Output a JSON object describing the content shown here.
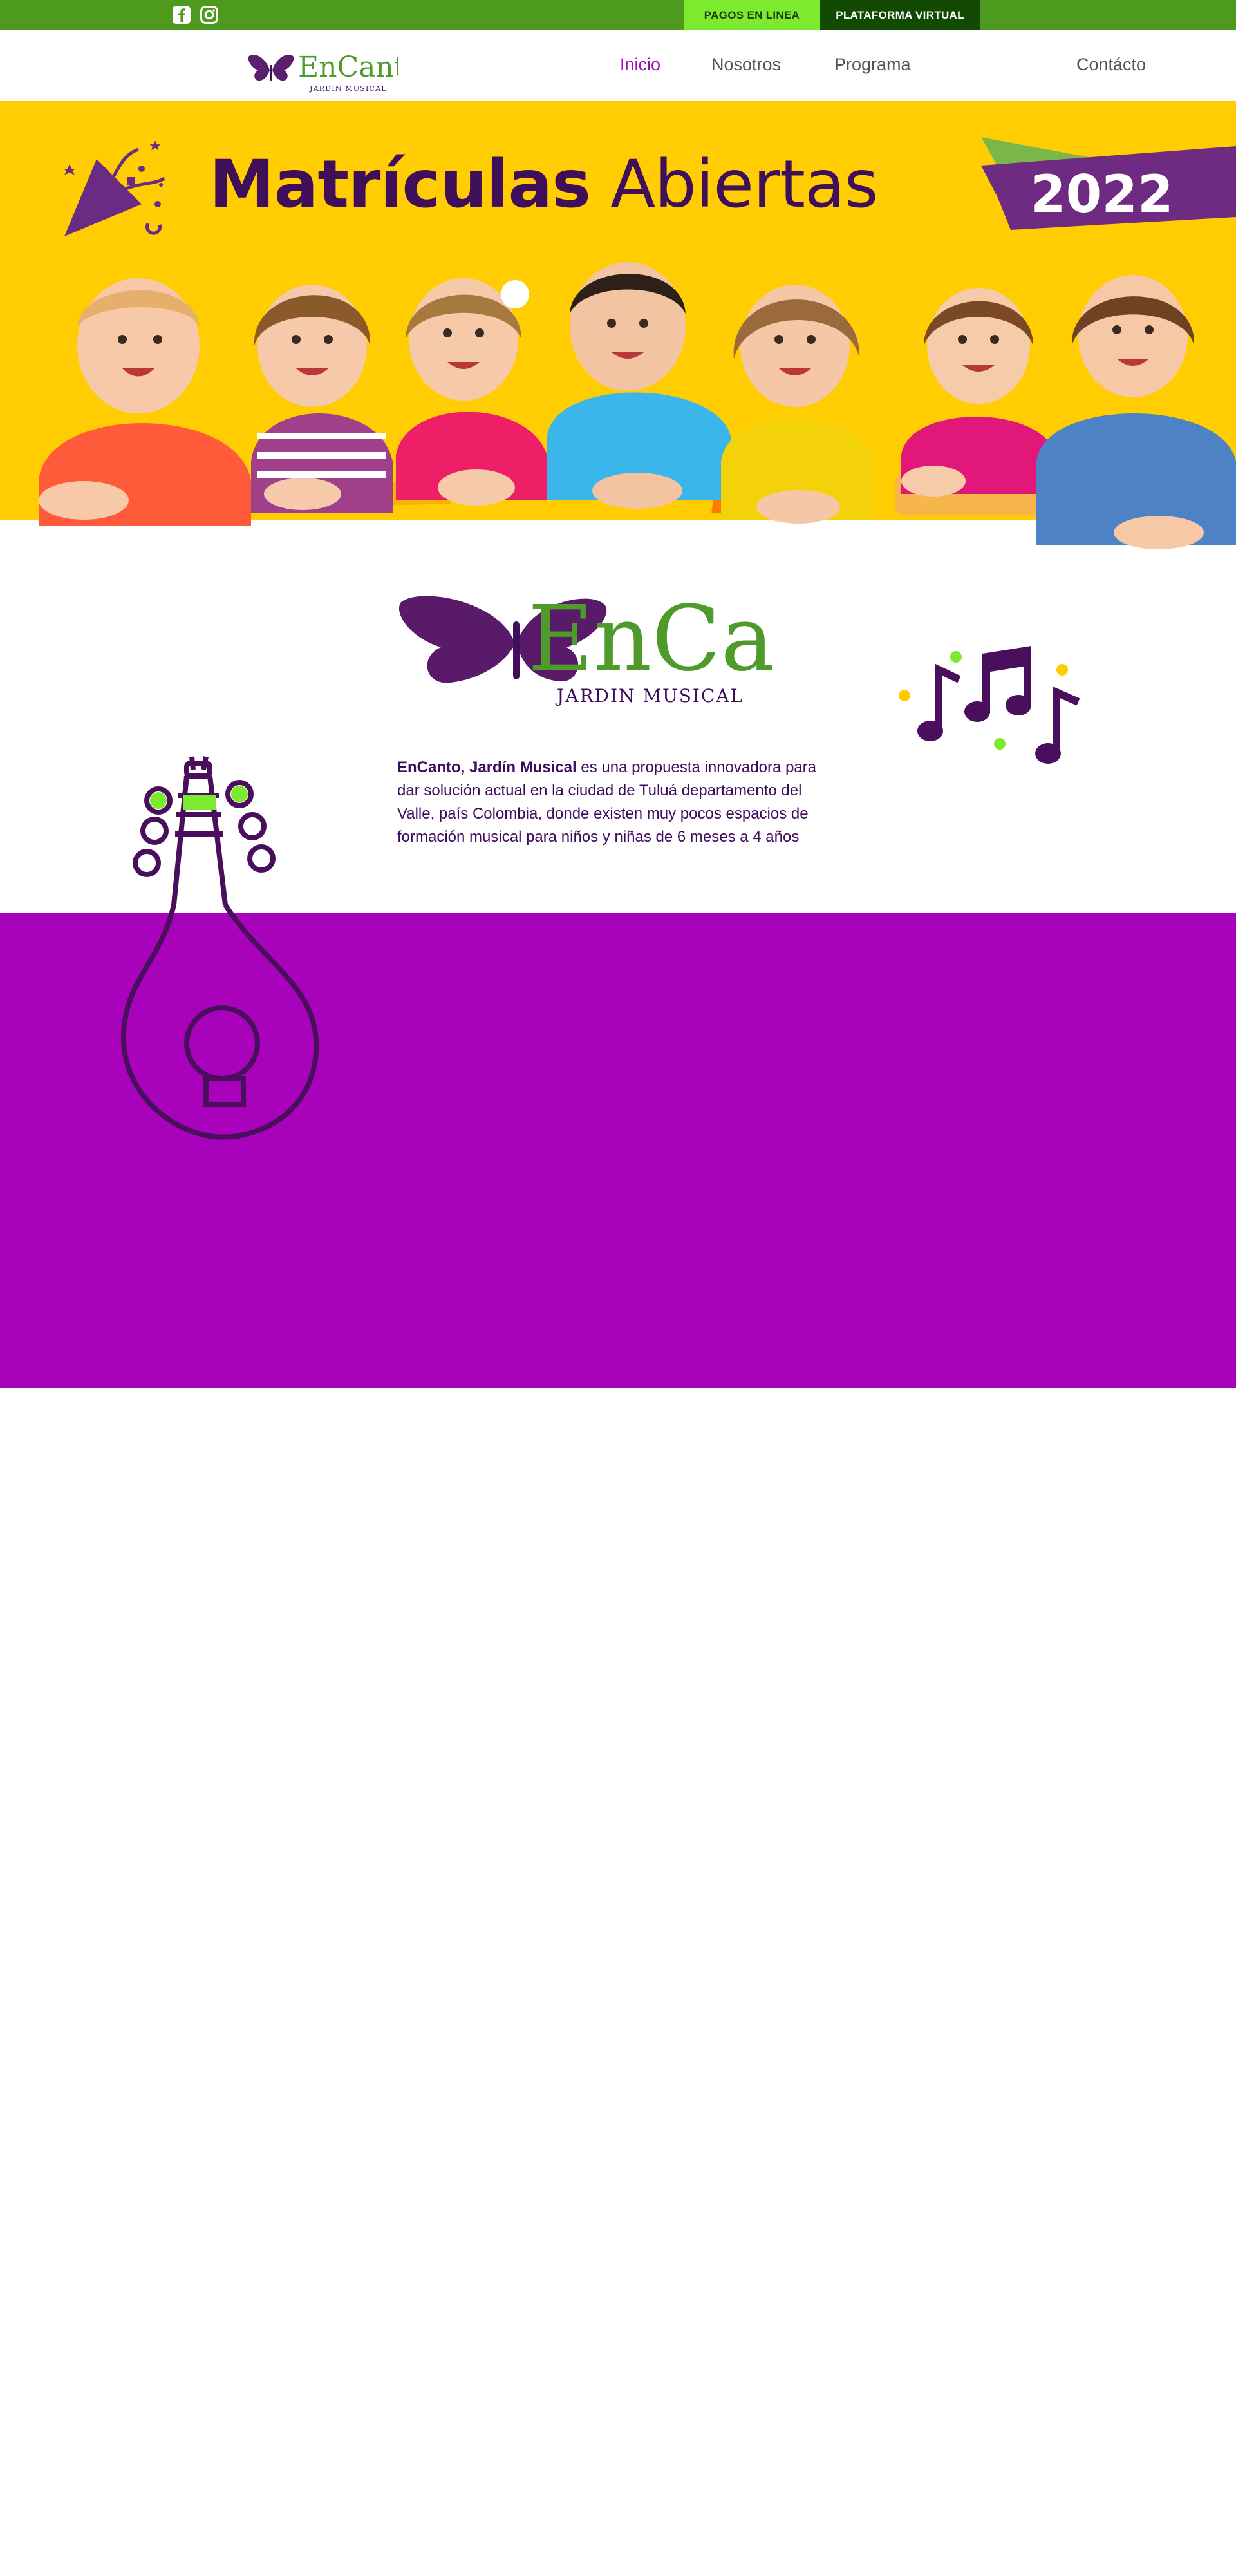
{
  "topbar": {
    "social": [
      "facebook-icon",
      "instagram-icon"
    ],
    "pay_label": "PAGOS EN LINEA",
    "platform_label": "PLATAFORMA VIRTUAL"
  },
  "logo": {
    "name": "EnCanto",
    "subtitle": "JARDIN MUSICAL"
  },
  "nav": {
    "items": [
      "Inicio",
      "Nosotros",
      "Programa",
      "Contácto"
    ],
    "active": "Inicio"
  },
  "hero": {
    "title_bold": "Matrículas",
    "title_light": "Abiertas",
    "year": "2022"
  },
  "intro": {
    "name": "EnCanto",
    "subtitle": "JARDIN MUSICAL",
    "text_bold": "EnCanto, Jardín Musical",
    "text_rest": " es una propuesta innovadora para dar solución actual en la ciudad de Tuluá departamento del Valle, país Colombia, donde existen muy pocos espacios de formación musical para niños y niñas de 6 meses a 4 años"
  },
  "colors": {
    "top_green": "#4e9a1e",
    "pay_green": "#7cea2e",
    "dark_green": "#124a04",
    "nav_active": "#a20bb8",
    "hero_yellow": "#ffcd02",
    "deep_purple": "#3f0f5a",
    "section_purple": "#a902bb"
  }
}
